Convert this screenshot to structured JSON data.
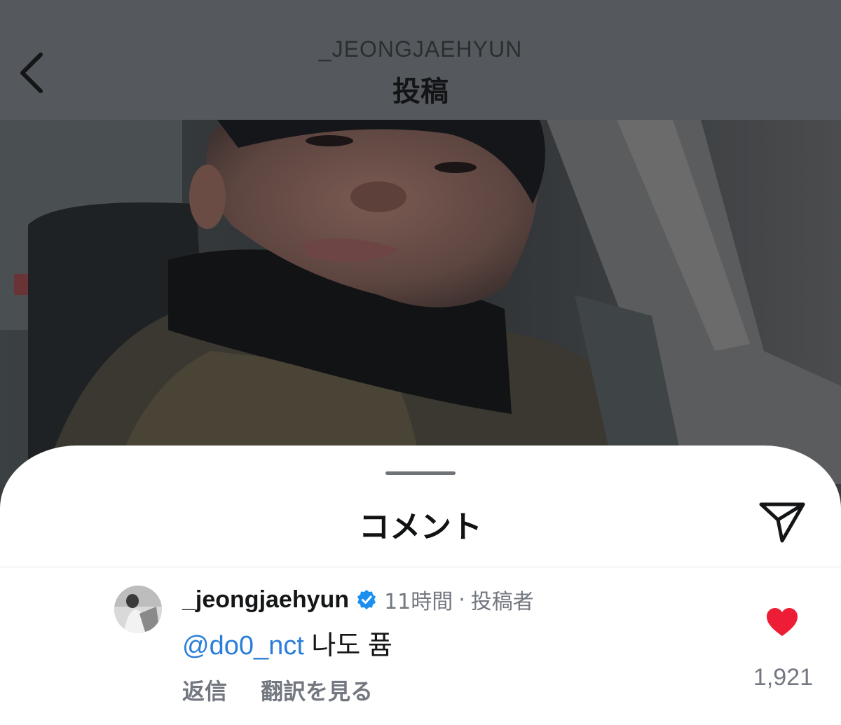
{
  "header": {
    "username": "_JEONGJAEHYUN",
    "title": "投稿",
    "back_icon": "chevron-left-icon"
  },
  "post": {
    "image_description_icon": "photo"
  },
  "sheet": {
    "title": "コメント",
    "share_icon": "paper-plane-icon"
  },
  "comment": {
    "username": "_jeongjaehyun",
    "verified_icon": "verified-badge-icon",
    "time": "11時間",
    "separator": "·",
    "author_tag": "投稿者",
    "mention": "@do0_nct",
    "text": " 나도 퓸",
    "reply_label": "返信",
    "translate_label": "翻訳を見る",
    "like_icon": "heart-filled-icon",
    "like_count": "1,921"
  },
  "colors": {
    "mention": "#2a7ed9",
    "heart": "#ee1d36",
    "verified": "#1a8ff0",
    "secondary_text": "#737880"
  }
}
